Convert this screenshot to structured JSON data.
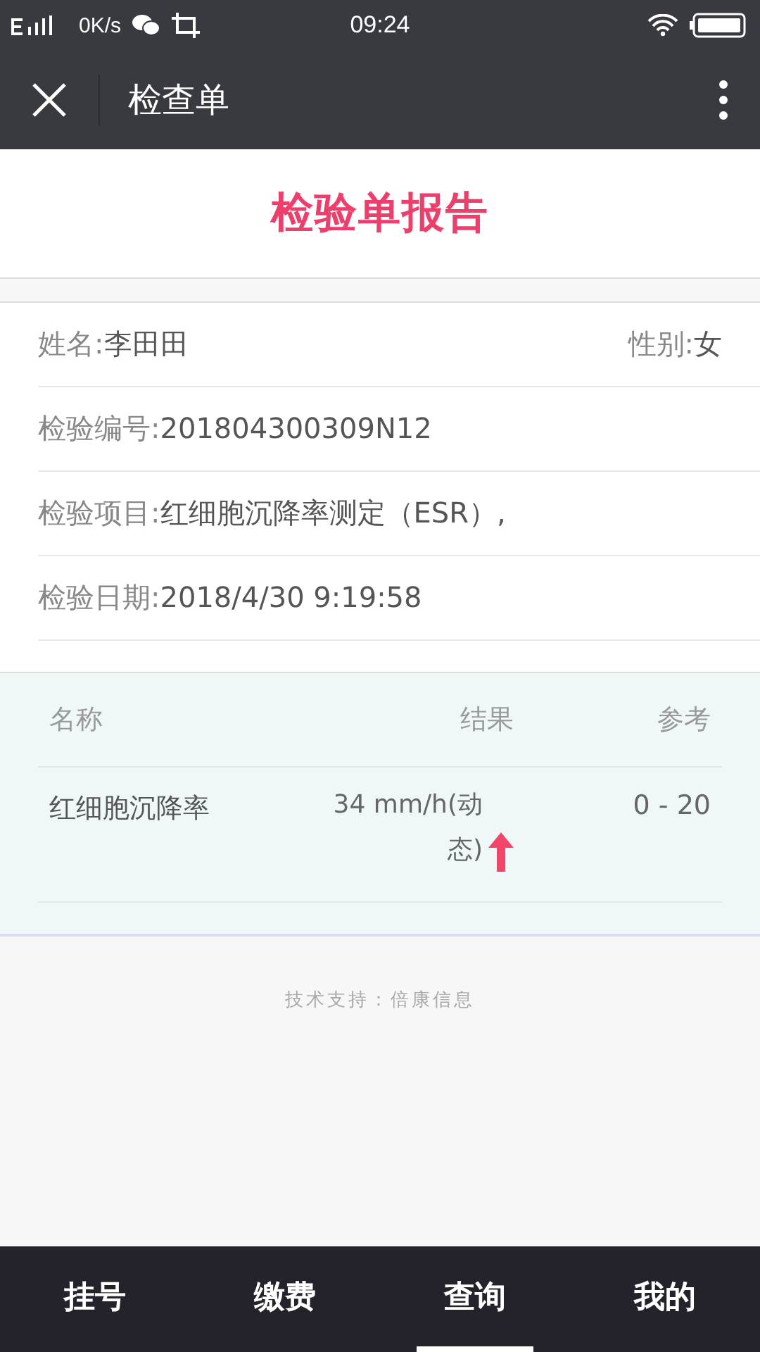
{
  "status_bar": {
    "speed": "0K/s",
    "time": "09:24"
  },
  "nav": {
    "title": "检查单"
  },
  "banner": {
    "title": "检验单报告"
  },
  "info": {
    "name_label": "姓名:",
    "name": "李田田",
    "sex_label": "性别:",
    "sex": "女",
    "rows": [
      {
        "label": "检验编号:",
        "value": "201804300309N12"
      },
      {
        "label": "检验项目:",
        "value": "红细胞沉降率测定（ESR）,"
      },
      {
        "label": "检验日期:",
        "value": "2018/4/30 9:19:58"
      }
    ]
  },
  "table": {
    "columns": [
      "名称",
      "结果",
      "参考"
    ],
    "rows": [
      {
        "name": "红细胞沉降率",
        "result": "34 mm/h(动态)",
        "high": true,
        "reference": "0 - 20"
      }
    ]
  },
  "footer": "技术支持：倍康信息",
  "tabs": [
    {
      "label": "挂号",
      "selected": false
    },
    {
      "label": "缴费",
      "selected": false
    },
    {
      "label": "查询",
      "selected": true
    },
    {
      "label": "我的",
      "selected": false
    }
  ]
}
